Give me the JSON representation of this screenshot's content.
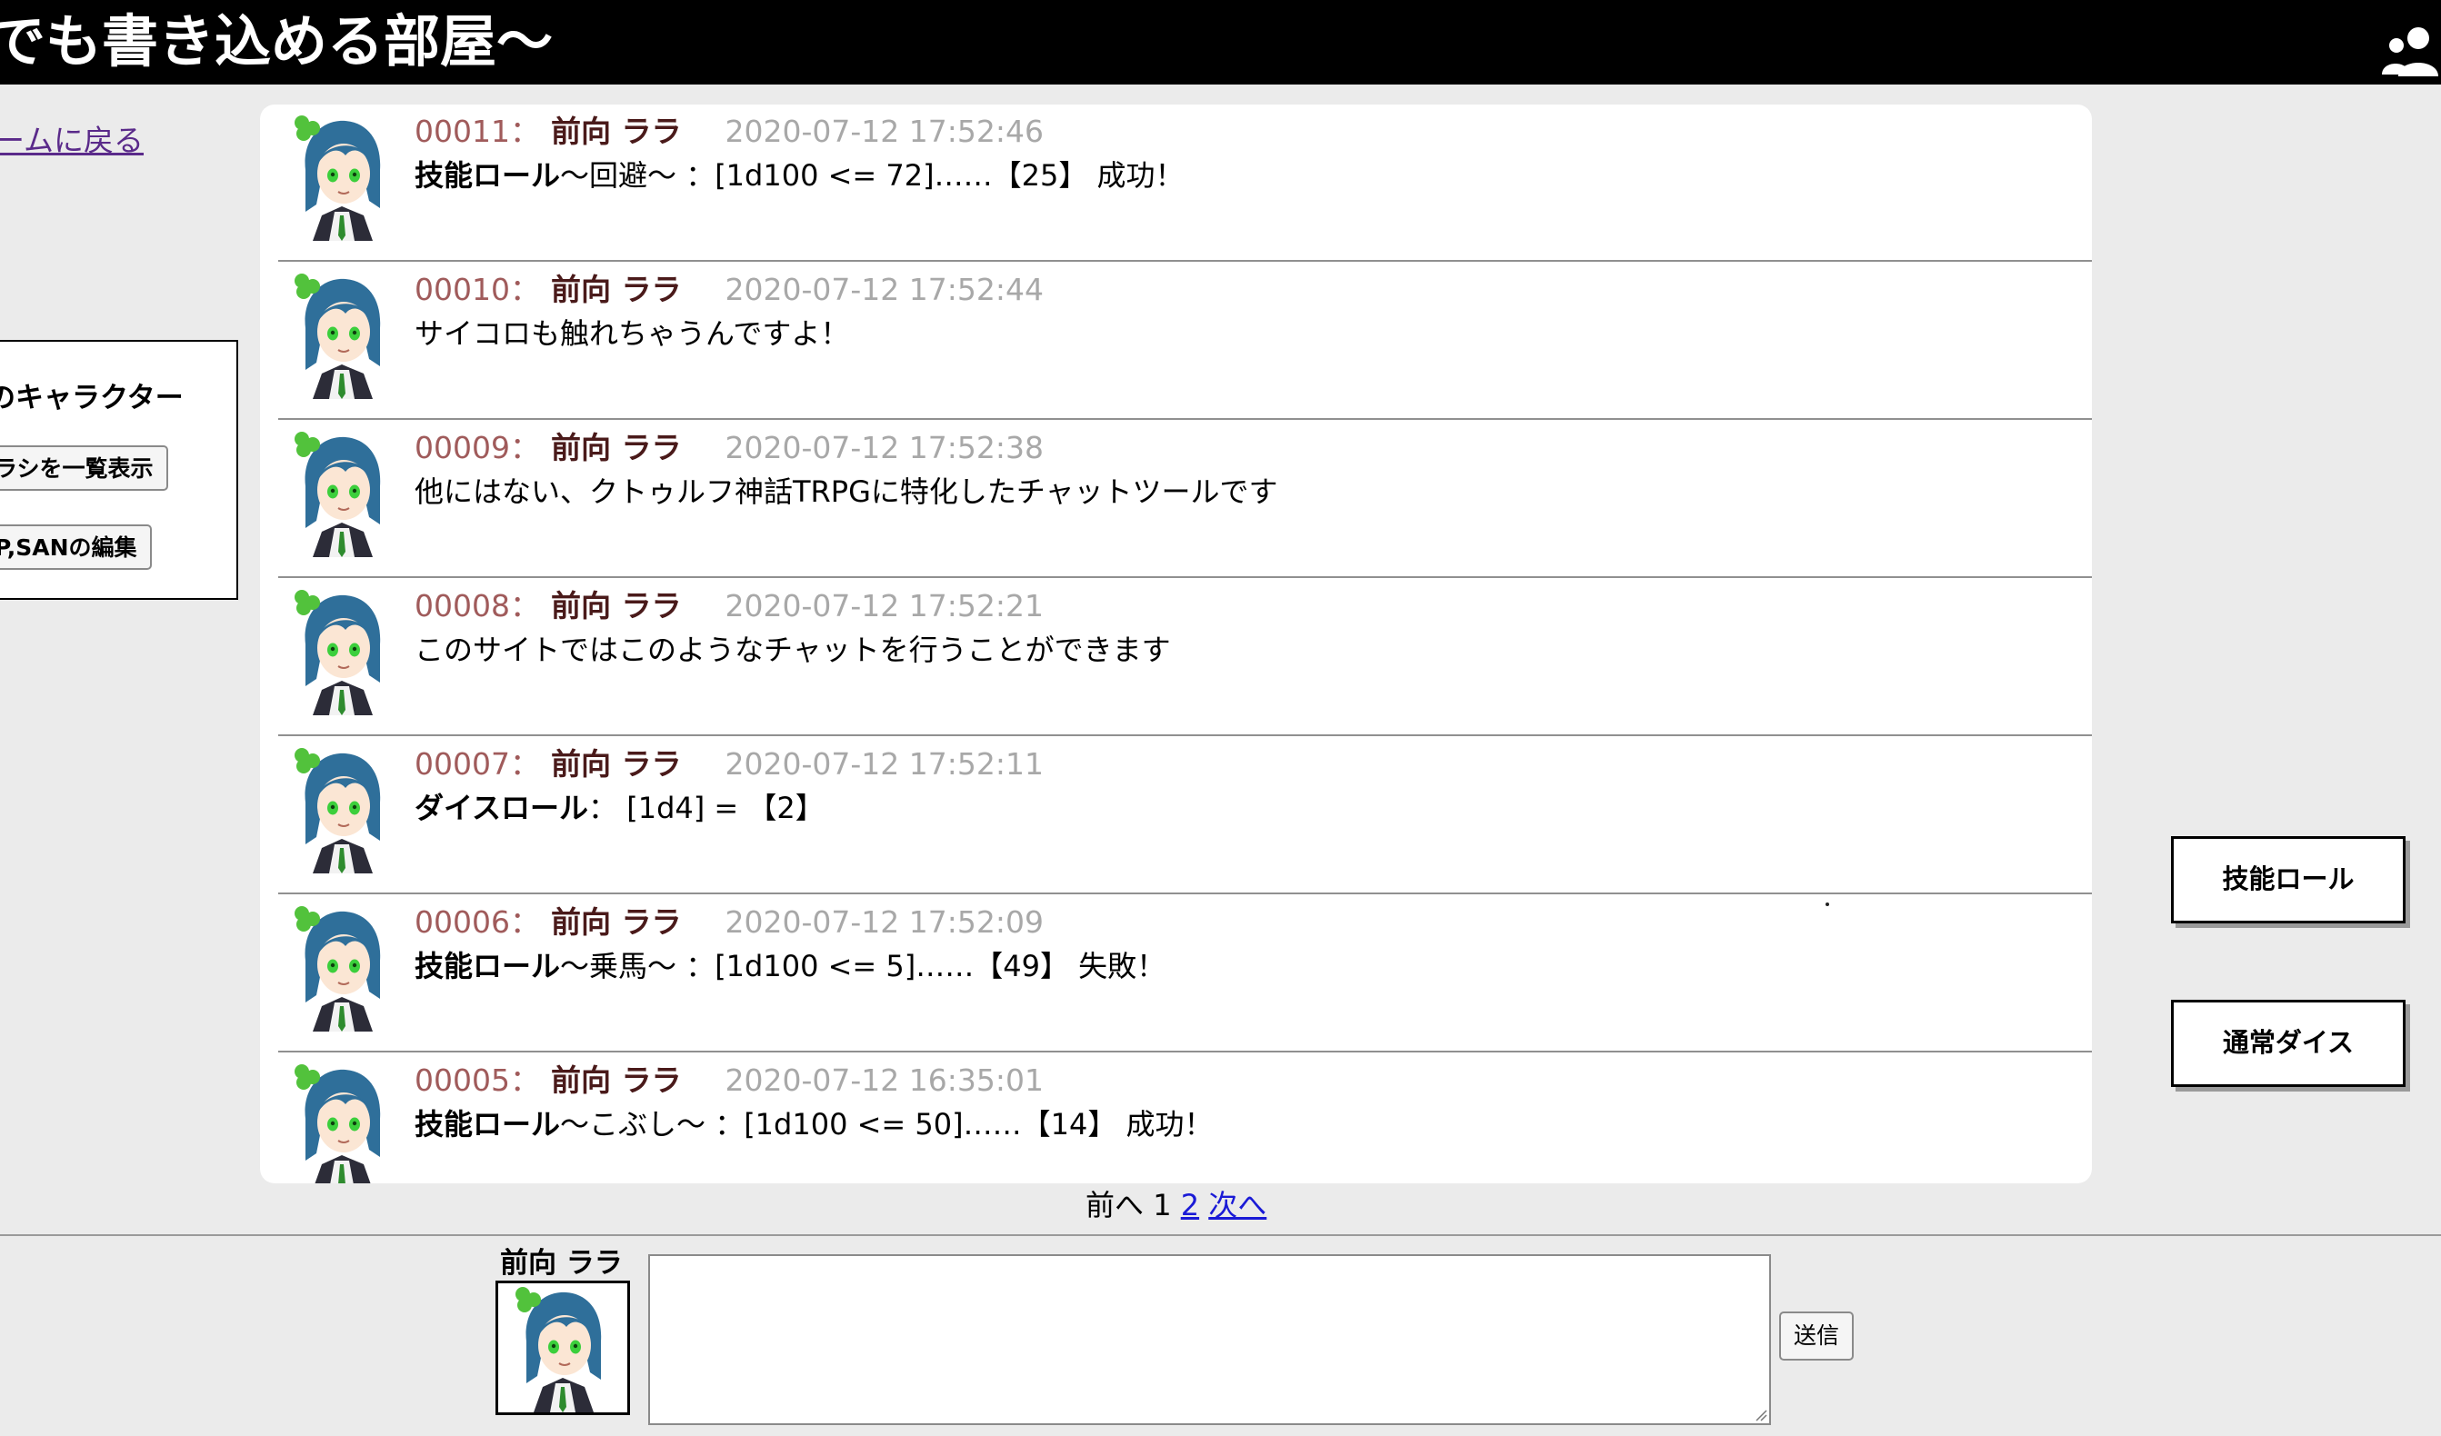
{
  "header": {
    "title": "でも書き込める部屋〜",
    "users_icon": "users-icon"
  },
  "nav": {
    "back_link": "ームに戻る"
  },
  "character_panel": {
    "title": "のキャラクター",
    "list_button": "ラシを一覧表示",
    "edit_button": "P,SANの編集"
  },
  "messages": [
    {
      "num": "00011：",
      "name": "前向 ララ",
      "time": "2020-07-12 17:52:46",
      "kind": "技能ロール",
      "text": "〜回避〜 ：[1d100 <= 72]……【25】 成功！"
    },
    {
      "num": "00010：",
      "name": "前向 ララ",
      "time": "2020-07-12 17:52:44",
      "kind": "",
      "text": "サイコロも触れちゃうんですよ！"
    },
    {
      "num": "00009：",
      "name": "前向 ララ",
      "time": "2020-07-12 17:52:38",
      "kind": "",
      "text": "他にはない、クトゥルフ神話TRPGに特化したチャットツールです"
    },
    {
      "num": "00008：",
      "name": "前向 ララ",
      "time": "2020-07-12 17:52:21",
      "kind": "",
      "text": "このサイトではこのようなチャットを行うことができます"
    },
    {
      "num": "00007：",
      "name": "前向 ララ",
      "time": "2020-07-12 17:52:11",
      "kind": "ダイスロール",
      "text": "： [1d4] = 【2】"
    },
    {
      "num": "00006：",
      "name": "前向 ララ",
      "time": "2020-07-12 17:52:09",
      "kind": "技能ロール",
      "text": "〜乗馬〜 ：[1d100 <= 5]……【49】 失敗！"
    },
    {
      "num": "00005：",
      "name": "前向 ララ",
      "time": "2020-07-12 16:35:01",
      "kind": "技能ロール",
      "text": "〜こぶし〜 ：[1d100 <= 50]……【14】 成功！"
    }
  ],
  "side_buttons": {
    "skill_roll": "技能ロール",
    "normal_dice": "通常ダイス"
  },
  "pagination": {
    "prev": "前へ",
    "page1": "1",
    "page2": "2",
    "next": "次へ"
  },
  "composer": {
    "speaker_name": "前向 ララ",
    "message_value": "",
    "send_label": "送信"
  },
  "colors": {
    "header_bg": "#000000",
    "message_number": "#a05b5b",
    "speaker_name": "#4a1a1a",
    "timestamp": "#a8a8a8",
    "link": "#1a1ad6"
  }
}
